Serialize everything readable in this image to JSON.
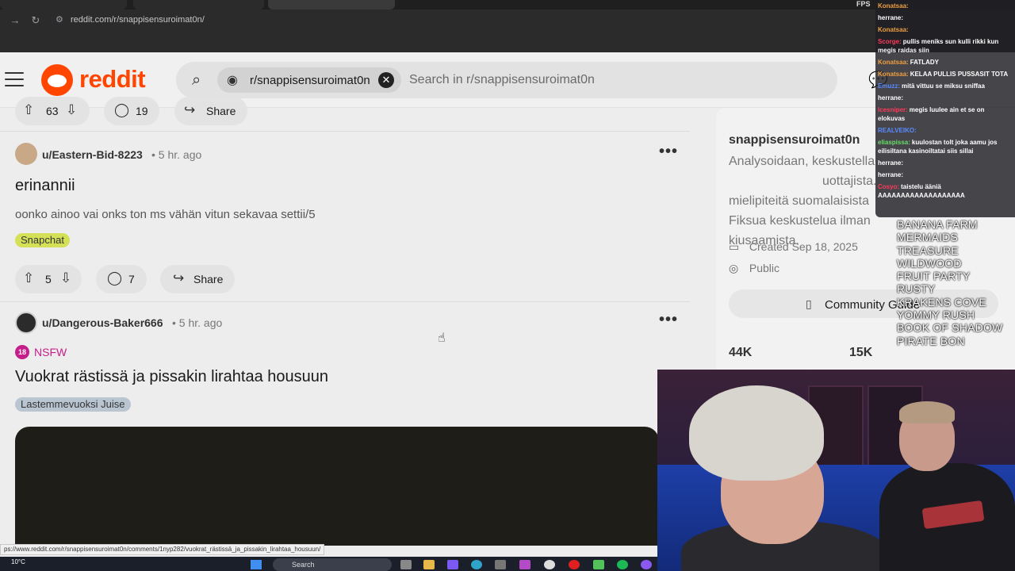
{
  "browser": {
    "url": "reddit.com/r/snappisensuroimat0n/",
    "fps_label": "FPS",
    "status_url": "ps://www.reddit.com/r/snappisensuroimat0n/comments/1nyp282/vuokrat_rästissä_ja_pissakin_lirahtaa_housuun/"
  },
  "header": {
    "logo_text": "reddit",
    "search_chip": "r/snappisensuroimat0n",
    "search_placeholder": "Search in r/snappisensuroimat0n"
  },
  "feed": {
    "prev_post_actions": {
      "votes": "63",
      "comments": "19",
      "share": "Share"
    },
    "posts": [
      {
        "user": "u/Eastern-Bid-8223",
        "time": "• 5 hr. ago",
        "title": "erinannii",
        "body": "oonko ainoo vai onks ton ms vähän vitun sekavaa settii/5",
        "flair": "Snapchat",
        "votes": "5",
        "comments": "7",
        "share": "Share"
      },
      {
        "user": "u/Dangerous-Baker666",
        "time": "• 5 hr. ago",
        "nsfw_label": "NSFW",
        "nsfw_num": "18",
        "title": "Vuokrat rästissä ja pissakin lirahtaa housuun",
        "flair": "Lastemmevuoksi Juise"
      }
    ]
  },
  "sidebar": {
    "name": "snappisensuroimat0n",
    "desc_line1": "Analysoidaan, keskustella",
    "desc_line1b": "uottajista.",
    "desc_line2": "mielipiteitä suomalaisista",
    "desc_line3": "Fiksua keskustelua ilman",
    "desc_line4": "kiusaamista.",
    "created": "Created Sep 18, 2025",
    "visibility": "Public",
    "guide_button": "Community Guide",
    "stat1": "44K",
    "stat2": "15K"
  },
  "chat": {
    "messages": [
      {
        "name": "Konatsaa:",
        "color": "#f0a040",
        "text": ""
      },
      {
        "name": "herrane:",
        "color": "#ffffff",
        "text": ""
      },
      {
        "name": "Konatsaa:",
        "color": "#f0a040",
        "text": ""
      },
      {
        "name": "Scorge:",
        "color": "#ff3a5a",
        "text": "pullis meniks sun kulli rikki kun megis raidas siin"
      },
      {
        "name": "Konatsaa:",
        "color": "#f0a040",
        "text": "FATLADY"
      },
      {
        "name": "Konatsaa:",
        "color": "#f0a040",
        "text": "KELAA PULLIS PUSSASIT TOTA"
      },
      {
        "name": "Emuzz:",
        "color": "#5a8aff",
        "text": "mitä vittuu se miksu sniffaa"
      },
      {
        "name": "herrane:",
        "color": "#ffffff",
        "text": ""
      },
      {
        "name": "Icesniper:",
        "color": "#ff3a5a",
        "text": "megis luulee ain et se on elokuvas"
      },
      {
        "name": "REALVEIKO:",
        "color": "#5a8aff",
        "text": ""
      },
      {
        "name": "eliaspissa:",
        "color": "#6adf6a",
        "text": "kuulostan tolt joka aamu jos eilisiltana kasinoiltatai siis sillai"
      },
      {
        "name": "herrane:",
        "color": "#ffffff",
        "text": ""
      },
      {
        "name": "herrane:",
        "color": "#ffffff",
        "text": ""
      },
      {
        "name": "Cosyo:",
        "color": "#ff3a5a",
        "text": "taistelu ääniä AAAAAAAAAAAAAAAAAAA"
      }
    ]
  },
  "games": [
    "BANANA FARM",
    "MERMAIDS TREASURE",
    "WILDWOOD",
    "FRUIT PARTY",
    "RUSTY",
    "KRAKENS COVE",
    "YOMMY RUSH",
    "BOOK OF SHADOW",
    "PIRATE BON"
  ],
  "taskbar": {
    "weather": "10°C",
    "search": "Search"
  },
  "colors": {
    "brand": "#ff4500",
    "snapchat_flair": "#d4e157",
    "nsfw": "#c51e8a",
    "juise_flair": "#b9c6d2"
  }
}
